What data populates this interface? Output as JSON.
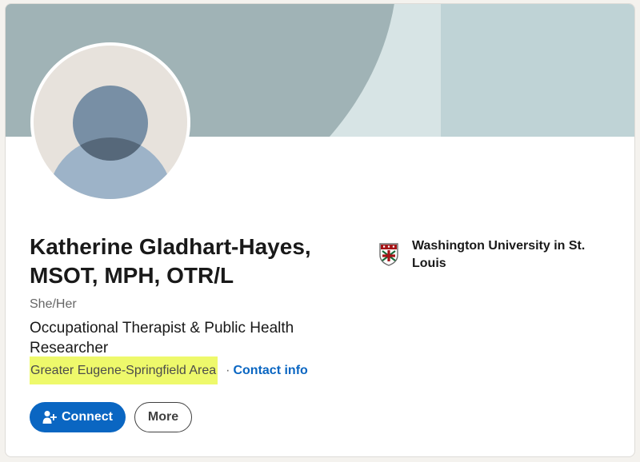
{
  "profile": {
    "name": "Katherine Gladhart-Hayes, MSOT, MPH, OTR/L",
    "pronouns": "She/Her",
    "headline": "Occupational Therapist & Public Health Researcher",
    "location": "Greater Eugene-Springfield Area",
    "separator": "·",
    "contact_info_label": "Contact info"
  },
  "organization": {
    "name": "Washington University in St. Louis",
    "logo_icon": "university-shield-icon"
  },
  "actions": {
    "connect_label": "Connect",
    "connect_icon": "add-person-icon",
    "more_label": "More"
  },
  "colors": {
    "accent": "#0a66c2",
    "highlight": "#eef96b",
    "banner": "#a0b3b6"
  }
}
